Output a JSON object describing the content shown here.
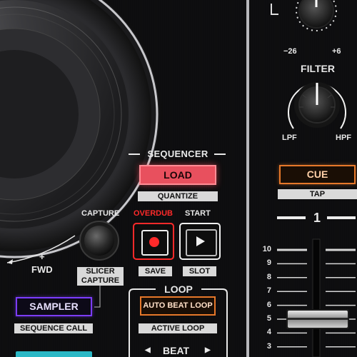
{
  "sequencer": {
    "title": "SEQUENCER",
    "load_label": "LOAD",
    "quantize_label": "QUANTIZE",
    "capture_label": "CAPTURE",
    "overdub_label": "OVERDUB",
    "start_label": "START",
    "slicer_capture_label_1": "SLICER",
    "slicer_capture_label_2": "CAPTURE",
    "save_label": "SAVE",
    "slot_label": "SLOT"
  },
  "jog": {
    "direction_sign": "+",
    "direction_label": "FWD"
  },
  "sampler": {
    "button_label": "SAMPLER",
    "sub_label": "SEQUENCE CALL"
  },
  "loop": {
    "title": "LOOP",
    "auto_beat_loop_label": "AUTO BEAT LOOP",
    "active_loop_label": "ACTIVE LOOP",
    "beat_label": "BEAT"
  },
  "mixer": {
    "trim_min": "−26",
    "trim_max": "+6",
    "filter_label": "FILTER",
    "lpf_label": "LPF",
    "hpf_label": "HPF",
    "cue_label": "CUE",
    "tap_label": "TAP",
    "channel_number": "1",
    "fader_scale": [
      "10",
      "9",
      "8",
      "7",
      "6",
      "5",
      "4",
      "3"
    ]
  },
  "colors": {
    "load_fill": "#e8505e",
    "load_text": "#1a0507",
    "cue_border": "#e6782a",
    "sampler_border": "#7c3cff",
    "auto_beat_border": "#e6782a",
    "overdub_red": "#ff2a2a"
  }
}
